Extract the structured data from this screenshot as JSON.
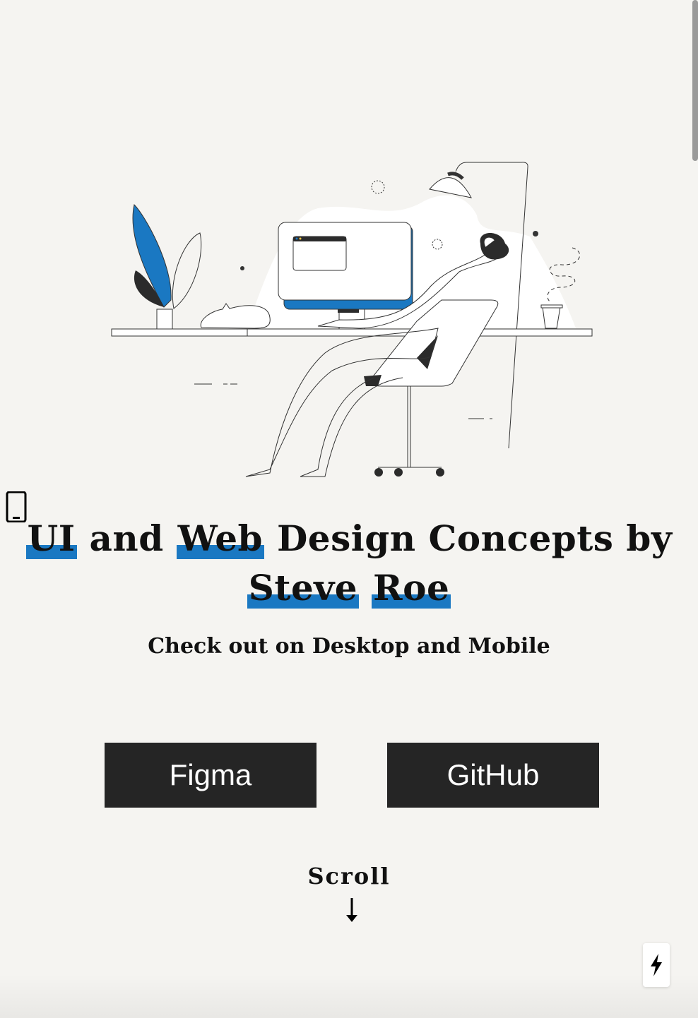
{
  "hero": {
    "title_words": [
      "UI",
      "and",
      "Web",
      "Design",
      "Concepts",
      "by",
      "Steve",
      "Roe"
    ],
    "subtitle": "Check out on Desktop and Mobile"
  },
  "buttons": {
    "figma": "Figma",
    "github": "GitHub"
  },
  "scroll": {
    "label": "Scroll"
  },
  "icons": {
    "device": "mobile-phone-icon",
    "scroll_arrow": "arrow-down-icon",
    "fab": "lightning-bolt-icon"
  },
  "colors": {
    "accent": "#1a78c2",
    "button_bg": "#252525",
    "page_bg": "#f5f4f1"
  }
}
